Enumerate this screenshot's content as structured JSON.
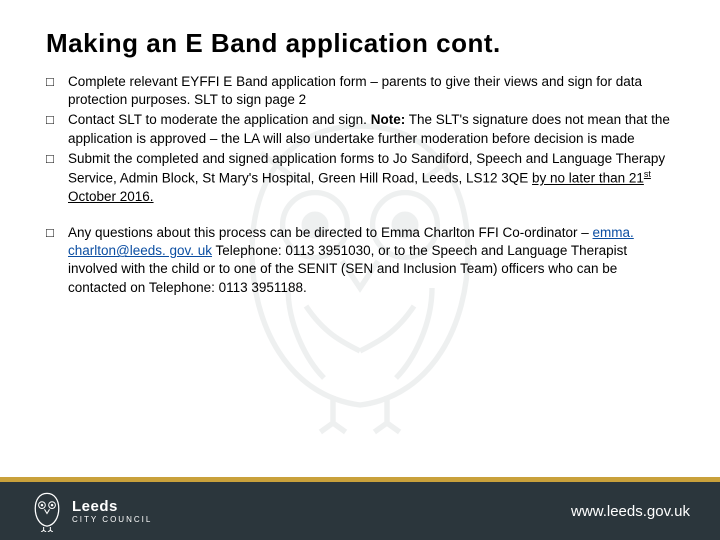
{
  "title": "Making an E Band application cont.",
  "bullets": [
    {
      "parts": [
        {
          "text": "Complete relevant EYFFI E Band application form – parents to give their views and sign for data protection purposes.  SLT to sign page 2"
        }
      ]
    },
    {
      "parts": [
        {
          "text": "Contact SLT to moderate the application and sign.  "
        },
        {
          "text": "Note:",
          "bold": true
        },
        {
          "text": " The SLT's signature does not mean that the application is approved – the LA will also undertake further moderation before decision is made"
        }
      ]
    },
    {
      "parts": [
        {
          "text": "Submit the completed and signed application forms to Jo Sandiford, Speech and Language Therapy Service, Admin Block, St Mary's Hospital, Green Hill Road, Leeds, LS12 3QE "
        },
        {
          "text": "by no later than 21",
          "underline": true
        },
        {
          "text": "st",
          "underline": true,
          "sup": true
        },
        {
          "text": " October 2016.",
          "underline": true
        }
      ]
    },
    {
      "gap_before": true,
      "parts": [
        {
          "text": "Any questions about this process can be directed to Emma Charlton FFI Co-ordinator – "
        },
        {
          "text": "emma. charlton@leeds. gov. uk",
          "link": true
        },
        {
          "text": " Telephone: 0113 3951030, or to the Speech and Language Therapist involved with the child or to one of the SENIT (SEN and Inclusion Team) officers who can be contacted on Telephone: 0113 3951188."
        }
      ]
    }
  ],
  "footer": {
    "city": "Leeds",
    "council": "CITY COUNCIL",
    "url": "www.leeds.gov.uk"
  }
}
